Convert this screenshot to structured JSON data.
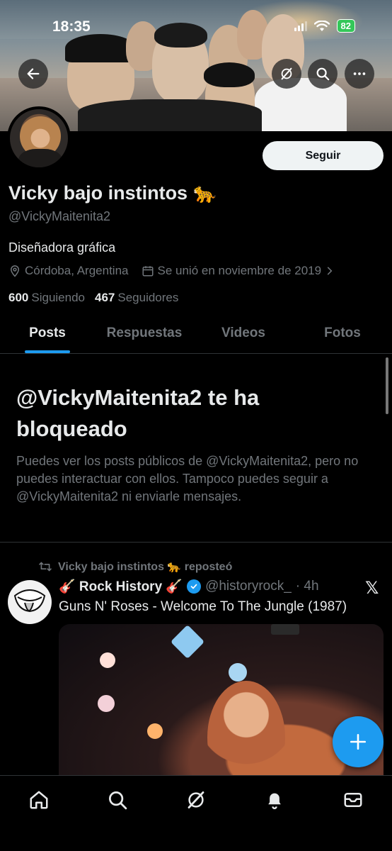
{
  "status_bar": {
    "time": "18:35",
    "battery": "82"
  },
  "header": {
    "follow_label": "Seguir"
  },
  "profile": {
    "name": "Vicky bajo instintos 🐆",
    "handle": "@VickyMaitenita2",
    "bio": "Diseñadora gráfica",
    "location": "Córdoba, Argentina",
    "joined": "Se unió en noviembre de 2019",
    "following_count": "600",
    "following_label": "Siguiendo",
    "followers_count": "467",
    "followers_label": "Seguidores"
  },
  "tabs": [
    {
      "label": "Posts",
      "active": true
    },
    {
      "label": "Respuestas",
      "active": false
    },
    {
      "label": "Videos",
      "active": false
    },
    {
      "label": "Fotos",
      "active": false
    }
  ],
  "blocked": {
    "title": "@VickyMaitenita2 te ha bloqueado",
    "text": "Puedes ver los posts públicos de @VickyMaitenita2, pero no puedes interactuar con ellos. Tampoco puedes seguir a @VickyMaitenita2 ni enviarle mensajes."
  },
  "post": {
    "repost_label": "Vicky bajo instintos 🐆 reposteó",
    "author_name": "🎸 Rock History 🎸",
    "author_handle": "@historyrock_",
    "time": "· 4h",
    "text": "Guns N' Roses - Welcome To The Jungle (1987)"
  },
  "icons": {
    "back": "back-arrow-icon",
    "grok": "grok-icon",
    "search": "search-icon",
    "more": "more-icon",
    "location": "location-pin-icon",
    "calendar": "calendar-icon",
    "repost": "repost-icon",
    "verified": "verified-badge-icon",
    "x": "x-logo-icon",
    "compose": "compose-plus-icon"
  },
  "colors": {
    "accent": "#1d9bf0",
    "background": "#000000",
    "muted": "#71767b",
    "battery": "#34c759"
  }
}
